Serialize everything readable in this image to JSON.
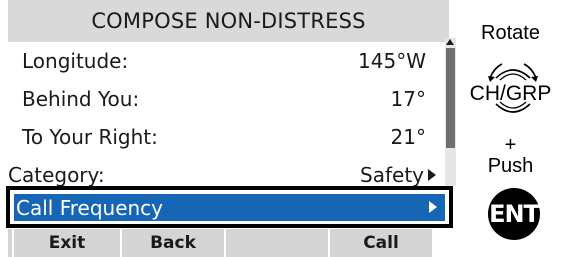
{
  "screen": {
    "title": "COMPOSE NON-DISTRESS",
    "rows": [
      {
        "label": "Longitude:",
        "value": "145°W"
      },
      {
        "label": "Behind You:",
        "value": "17°"
      },
      {
        "label": "To Your Right:",
        "value": "21°"
      }
    ],
    "category": {
      "label": "Category:",
      "value": "Safety"
    },
    "selected": {
      "label": "Call Frequency"
    },
    "softkeys": [
      "Exit",
      "Back",
      "",
      "Call"
    ]
  },
  "controls": {
    "rotate_label": "Rotate",
    "knob_label": "CH/GRP",
    "plus_label": "+",
    "push_label": "Push",
    "ent_label": "ENT"
  },
  "colors": {
    "selection": "#1766b5",
    "title_bar": "#d9d9d9",
    "softkey_bg": "#d4d4d4"
  },
  "icons": [
    "scroll-up-arrow",
    "right-arrow",
    "rotary-knob",
    "ent-key"
  ]
}
